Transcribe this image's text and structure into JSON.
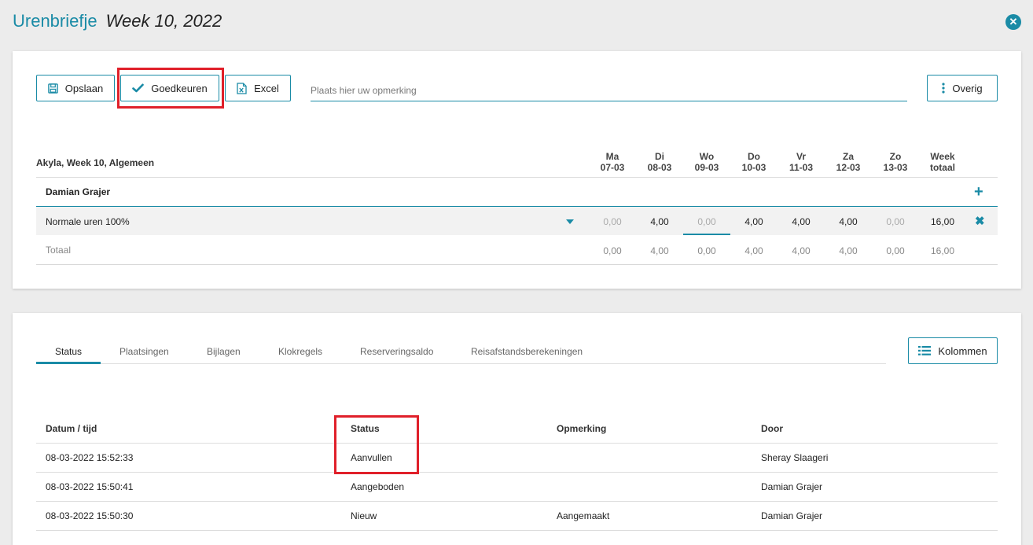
{
  "header": {
    "title": "Urenbriefje",
    "week": "Week 10, 2022"
  },
  "toolbar": {
    "save_label": "Opslaan",
    "approve_label": "Goedkeuren",
    "excel_label": "Excel",
    "remark_placeholder": "Plaats hier uw opmerking",
    "more_label": "Overig"
  },
  "timesheet": {
    "subtitle": "Akyla, Week 10, Algemeen",
    "days": [
      {
        "name": "Ma",
        "date": "07-03"
      },
      {
        "name": "Di",
        "date": "08-03"
      },
      {
        "name": "Wo",
        "date": "09-03"
      },
      {
        "name": "Do",
        "date": "10-03"
      },
      {
        "name": "Vr",
        "date": "11-03"
      },
      {
        "name": "Za",
        "date": "12-03"
      },
      {
        "name": "Zo",
        "date": "13-03"
      }
    ],
    "week_total_label": {
      "line1": "Week",
      "line2": "totaal"
    },
    "employee": "Damian Grajer",
    "row": {
      "label": "Normale uren 100%",
      "values": [
        "0,00",
        "4,00",
        "0,00",
        "4,00",
        "4,00",
        "4,00",
        "0,00"
      ],
      "total": "16,00"
    },
    "totals": {
      "label": "Totaal",
      "values": [
        "0,00",
        "4,00",
        "0,00",
        "4,00",
        "4,00",
        "4,00",
        "0,00"
      ],
      "total": "16,00"
    }
  },
  "tabs": [
    "Status",
    "Plaatsingen",
    "Bijlagen",
    "Klokregels",
    "Reserveringsaldo",
    "Reisafstandsberekeningen"
  ],
  "columns_button": "Kolommen",
  "status_table": {
    "headers": [
      "Datum / tijd",
      "Status",
      "Opmerking",
      "Door"
    ],
    "rows": [
      {
        "datetime": "08-03-2022 15:52:33",
        "status": "Aanvullen",
        "remark": "",
        "by": "Sheray Slaageri"
      },
      {
        "datetime": "08-03-2022 15:50:41",
        "status": "Aangeboden",
        "remark": "",
        "by": "Damian Grajer"
      },
      {
        "datetime": "08-03-2022 15:50:30",
        "status": "Nieuw",
        "remark": "Aangemaakt",
        "by": "Damian Grajer"
      }
    ]
  },
  "colors": {
    "accent": "#1a8ba6",
    "highlight": "#e0202a"
  }
}
